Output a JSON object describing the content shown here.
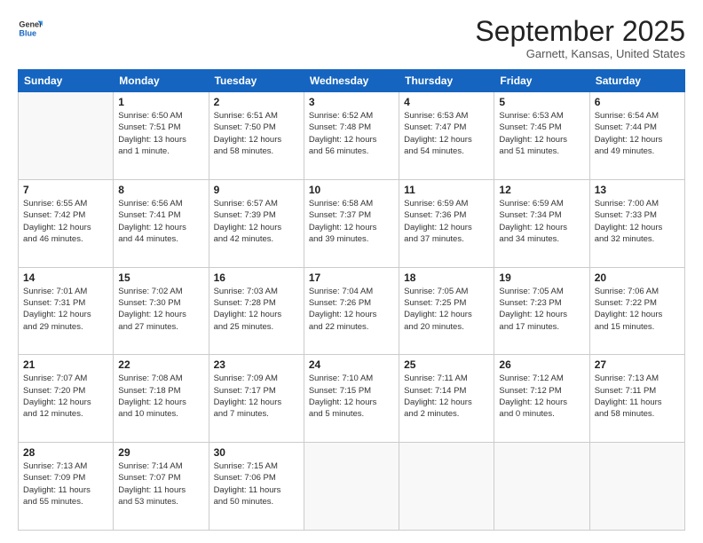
{
  "logo": {
    "line1": "General",
    "line2": "Blue"
  },
  "title": "September 2025",
  "location": "Garnett, Kansas, United States",
  "days_of_week": [
    "Sunday",
    "Monday",
    "Tuesday",
    "Wednesday",
    "Thursday",
    "Friday",
    "Saturday"
  ],
  "weeks": [
    [
      {
        "day": "",
        "info": ""
      },
      {
        "day": "1",
        "info": "Sunrise: 6:50 AM\nSunset: 7:51 PM\nDaylight: 13 hours\nand 1 minute."
      },
      {
        "day": "2",
        "info": "Sunrise: 6:51 AM\nSunset: 7:50 PM\nDaylight: 12 hours\nand 58 minutes."
      },
      {
        "day": "3",
        "info": "Sunrise: 6:52 AM\nSunset: 7:48 PM\nDaylight: 12 hours\nand 56 minutes."
      },
      {
        "day": "4",
        "info": "Sunrise: 6:53 AM\nSunset: 7:47 PM\nDaylight: 12 hours\nand 54 minutes."
      },
      {
        "day": "5",
        "info": "Sunrise: 6:53 AM\nSunset: 7:45 PM\nDaylight: 12 hours\nand 51 minutes."
      },
      {
        "day": "6",
        "info": "Sunrise: 6:54 AM\nSunset: 7:44 PM\nDaylight: 12 hours\nand 49 minutes."
      }
    ],
    [
      {
        "day": "7",
        "info": "Sunrise: 6:55 AM\nSunset: 7:42 PM\nDaylight: 12 hours\nand 46 minutes."
      },
      {
        "day": "8",
        "info": "Sunrise: 6:56 AM\nSunset: 7:41 PM\nDaylight: 12 hours\nand 44 minutes."
      },
      {
        "day": "9",
        "info": "Sunrise: 6:57 AM\nSunset: 7:39 PM\nDaylight: 12 hours\nand 42 minutes."
      },
      {
        "day": "10",
        "info": "Sunrise: 6:58 AM\nSunset: 7:37 PM\nDaylight: 12 hours\nand 39 minutes."
      },
      {
        "day": "11",
        "info": "Sunrise: 6:59 AM\nSunset: 7:36 PM\nDaylight: 12 hours\nand 37 minutes."
      },
      {
        "day": "12",
        "info": "Sunrise: 6:59 AM\nSunset: 7:34 PM\nDaylight: 12 hours\nand 34 minutes."
      },
      {
        "day": "13",
        "info": "Sunrise: 7:00 AM\nSunset: 7:33 PM\nDaylight: 12 hours\nand 32 minutes."
      }
    ],
    [
      {
        "day": "14",
        "info": "Sunrise: 7:01 AM\nSunset: 7:31 PM\nDaylight: 12 hours\nand 29 minutes."
      },
      {
        "day": "15",
        "info": "Sunrise: 7:02 AM\nSunset: 7:30 PM\nDaylight: 12 hours\nand 27 minutes."
      },
      {
        "day": "16",
        "info": "Sunrise: 7:03 AM\nSunset: 7:28 PM\nDaylight: 12 hours\nand 25 minutes."
      },
      {
        "day": "17",
        "info": "Sunrise: 7:04 AM\nSunset: 7:26 PM\nDaylight: 12 hours\nand 22 minutes."
      },
      {
        "day": "18",
        "info": "Sunrise: 7:05 AM\nSunset: 7:25 PM\nDaylight: 12 hours\nand 20 minutes."
      },
      {
        "day": "19",
        "info": "Sunrise: 7:05 AM\nSunset: 7:23 PM\nDaylight: 12 hours\nand 17 minutes."
      },
      {
        "day": "20",
        "info": "Sunrise: 7:06 AM\nSunset: 7:22 PM\nDaylight: 12 hours\nand 15 minutes."
      }
    ],
    [
      {
        "day": "21",
        "info": "Sunrise: 7:07 AM\nSunset: 7:20 PM\nDaylight: 12 hours\nand 12 minutes."
      },
      {
        "day": "22",
        "info": "Sunrise: 7:08 AM\nSunset: 7:18 PM\nDaylight: 12 hours\nand 10 minutes."
      },
      {
        "day": "23",
        "info": "Sunrise: 7:09 AM\nSunset: 7:17 PM\nDaylight: 12 hours\nand 7 minutes."
      },
      {
        "day": "24",
        "info": "Sunrise: 7:10 AM\nSunset: 7:15 PM\nDaylight: 12 hours\nand 5 minutes."
      },
      {
        "day": "25",
        "info": "Sunrise: 7:11 AM\nSunset: 7:14 PM\nDaylight: 12 hours\nand 2 minutes."
      },
      {
        "day": "26",
        "info": "Sunrise: 7:12 AM\nSunset: 7:12 PM\nDaylight: 12 hours\nand 0 minutes."
      },
      {
        "day": "27",
        "info": "Sunrise: 7:13 AM\nSunset: 7:11 PM\nDaylight: 11 hours\nand 58 minutes."
      }
    ],
    [
      {
        "day": "28",
        "info": "Sunrise: 7:13 AM\nSunset: 7:09 PM\nDaylight: 11 hours\nand 55 minutes."
      },
      {
        "day": "29",
        "info": "Sunrise: 7:14 AM\nSunset: 7:07 PM\nDaylight: 11 hours\nand 53 minutes."
      },
      {
        "day": "30",
        "info": "Sunrise: 7:15 AM\nSunset: 7:06 PM\nDaylight: 11 hours\nand 50 minutes."
      },
      {
        "day": "",
        "info": ""
      },
      {
        "day": "",
        "info": ""
      },
      {
        "day": "",
        "info": ""
      },
      {
        "day": "",
        "info": ""
      }
    ]
  ]
}
